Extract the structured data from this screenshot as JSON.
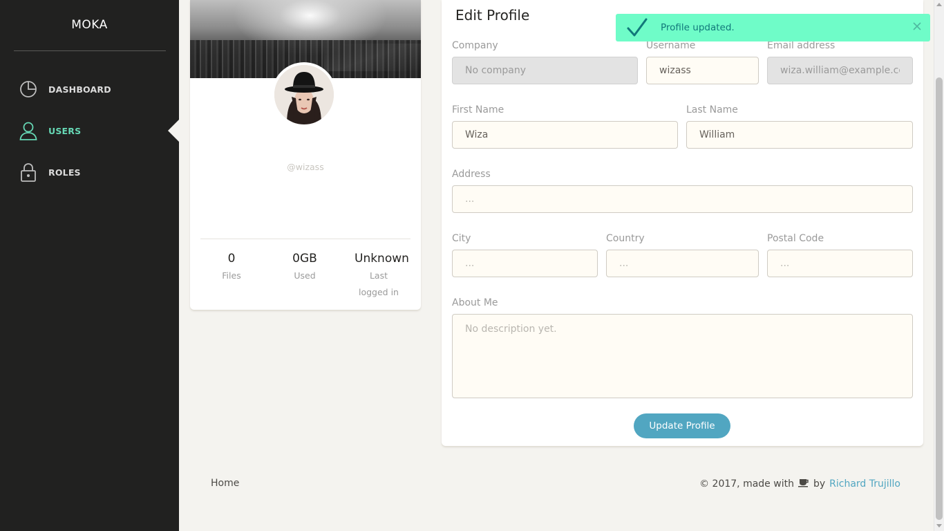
{
  "sidebar": {
    "logo": "MOKA",
    "items": [
      {
        "label": "DASHBOARD",
        "icon": "pie-chart-icon",
        "active": false
      },
      {
        "label": "USERS",
        "icon": "user-icon",
        "active": true
      },
      {
        "label": "ROLES",
        "icon": "lock-icon",
        "active": false
      }
    ]
  },
  "profile": {
    "handle": "@wizass",
    "stats": [
      {
        "value": "0",
        "label": "Files"
      },
      {
        "value": "0GB",
        "label": "Used"
      },
      {
        "value": "Unknown",
        "label": "Last logged in"
      }
    ]
  },
  "edit_profile": {
    "title": "Edit Profile",
    "fields": {
      "company": {
        "label": "Company",
        "value": "",
        "placeholder": "No company",
        "disabled": true
      },
      "username": {
        "label": "Username",
        "value": "wizass",
        "placeholder": ""
      },
      "email": {
        "label": "Email address",
        "value": "",
        "placeholder": "wiza.william@example.com",
        "disabled": true
      },
      "first_name": {
        "label": "First Name",
        "value": "Wiza",
        "placeholder": ""
      },
      "last_name": {
        "label": "Last Name",
        "value": "William",
        "placeholder": ""
      },
      "address": {
        "label": "Address",
        "value": "",
        "placeholder": "..."
      },
      "city": {
        "label": "City",
        "value": "",
        "placeholder": "..."
      },
      "country": {
        "label": "Country",
        "value": "",
        "placeholder": "..."
      },
      "postal_code": {
        "label": "Postal Code",
        "value": "",
        "placeholder": "..."
      },
      "about_me": {
        "label": "About Me",
        "value": "",
        "placeholder": "No description yet."
      }
    },
    "submit_label": "Update Profile"
  },
  "toast": {
    "message": "Profile updated.",
    "icon": "check-icon",
    "close_icon": "close-icon"
  },
  "footer": {
    "home_label": "Home",
    "credit_prefix": "© 2017, made with",
    "credit_icon": "coffee-icon",
    "credit_by": "by",
    "author": "Richard Trujillo"
  },
  "colors": {
    "sidebar_bg": "#212120",
    "accent_green": "#66d8b5",
    "button_blue": "#51a6c1",
    "toast_bg": "#6ffcc8",
    "toast_text": "#11787a",
    "page_bg": "#f4f3ef"
  }
}
